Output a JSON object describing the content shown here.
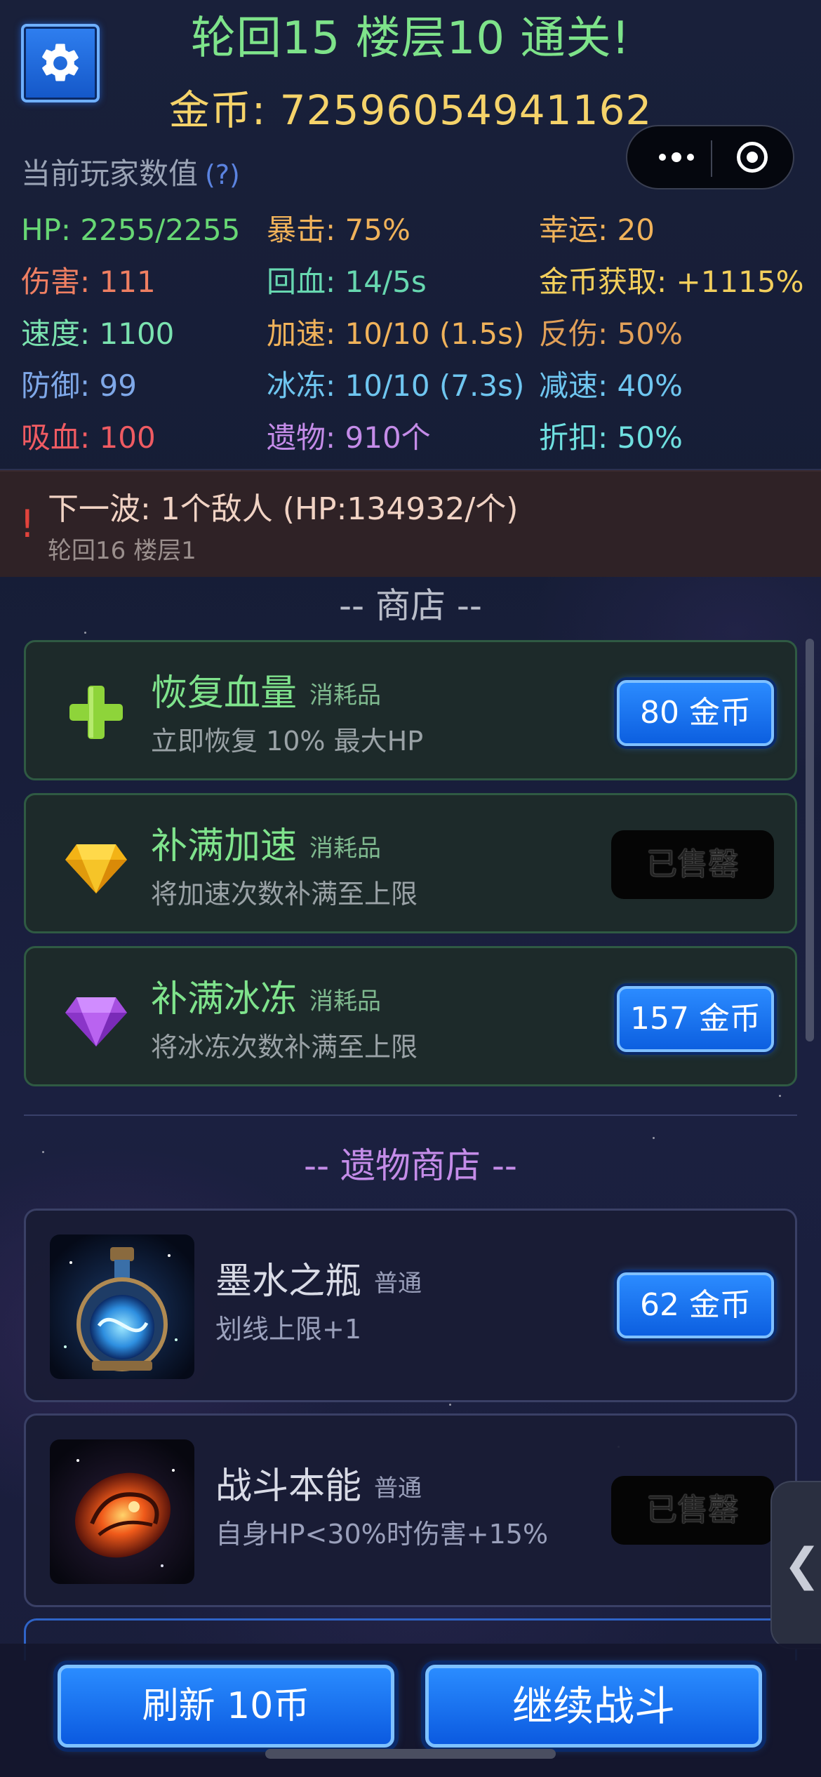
{
  "header": {
    "title": "轮回15 楼层10 通关!",
    "gold": "金币: 72596054941162",
    "settings_icon": "gear-icon"
  },
  "capsule": {
    "more_icon": "more-dots-icon",
    "close_icon": "close-target-icon"
  },
  "stats": {
    "title": "当前玩家数值",
    "help": "(?)",
    "items": [
      {
        "text": "HP: 2255/2255",
        "color": "#67d774"
      },
      {
        "text": "暴击: 75%",
        "color": "#f0b25a"
      },
      {
        "text": "幸运: 20",
        "color": "#f0b25a"
      },
      {
        "text": "伤害: 111",
        "color": "#ef7f62"
      },
      {
        "text": "回血: 14/5s",
        "color": "#67d7b0"
      },
      {
        "text": "金币获取: +1115%",
        "color": "#f3cf5c"
      },
      {
        "text": "速度: 1100",
        "color": "#7be3b0"
      },
      {
        "text": "加速: 10/10 (1.5s)",
        "color": "#f0b25a"
      },
      {
        "text": "反伤: 50%",
        "color": "#e2a058"
      },
      {
        "text": "防御: 99",
        "color": "#7fa8e8"
      },
      {
        "text": "冰冻: 10/10 (7.3s)",
        "color": "#6fc6f0"
      },
      {
        "text": "减速: 40%",
        "color": "#6fc6f0"
      },
      {
        "text": "吸血: 100",
        "color": "#ef5b62"
      },
      {
        "text": "遗物: 910个",
        "color": "#c48ce8"
      },
      {
        "text": "折扣: 50%",
        "color": "#6fe0e0"
      }
    ]
  },
  "next_wave": {
    "alert": "!",
    "main": "下一波: 1个敌人 (HP:134932/个)",
    "sub": "轮回16 楼层1"
  },
  "shop": {
    "title": "-- 商店 --",
    "items": [
      {
        "icon": "plus-icon",
        "name": "恢复血量",
        "tag": "消耗品",
        "desc": "立即恢复 10% 最大HP",
        "price": "80 金币",
        "sold": false
      },
      {
        "icon": "yellow-gem-icon",
        "name": "补满加速",
        "tag": "消耗品",
        "desc": "将加速次数补满至上限",
        "price": "已售罄",
        "sold": true
      },
      {
        "icon": "purple-gem-icon",
        "name": "补满冰冻",
        "tag": "消耗品",
        "desc": "将冰冻次数补满至上限",
        "price": "157 金币",
        "sold": false
      }
    ]
  },
  "relic_shop": {
    "title": "-- 遗物商店 --",
    "items": [
      {
        "image": "ink-bottle-image",
        "name": "墨水之瓶",
        "tag": "普通",
        "desc": "划线上限+1",
        "price": "62 金币",
        "sold": false
      },
      {
        "image": "flaming-fist-image",
        "name": "战斗本能",
        "tag": "普通",
        "desc": "自身HP<30%时伤害+15%",
        "price": "已售罄",
        "sold": true
      }
    ]
  },
  "side_tab": {
    "glyph": "❮"
  },
  "bottom": {
    "refresh": "刷新 10币",
    "continue": "继续战斗"
  }
}
